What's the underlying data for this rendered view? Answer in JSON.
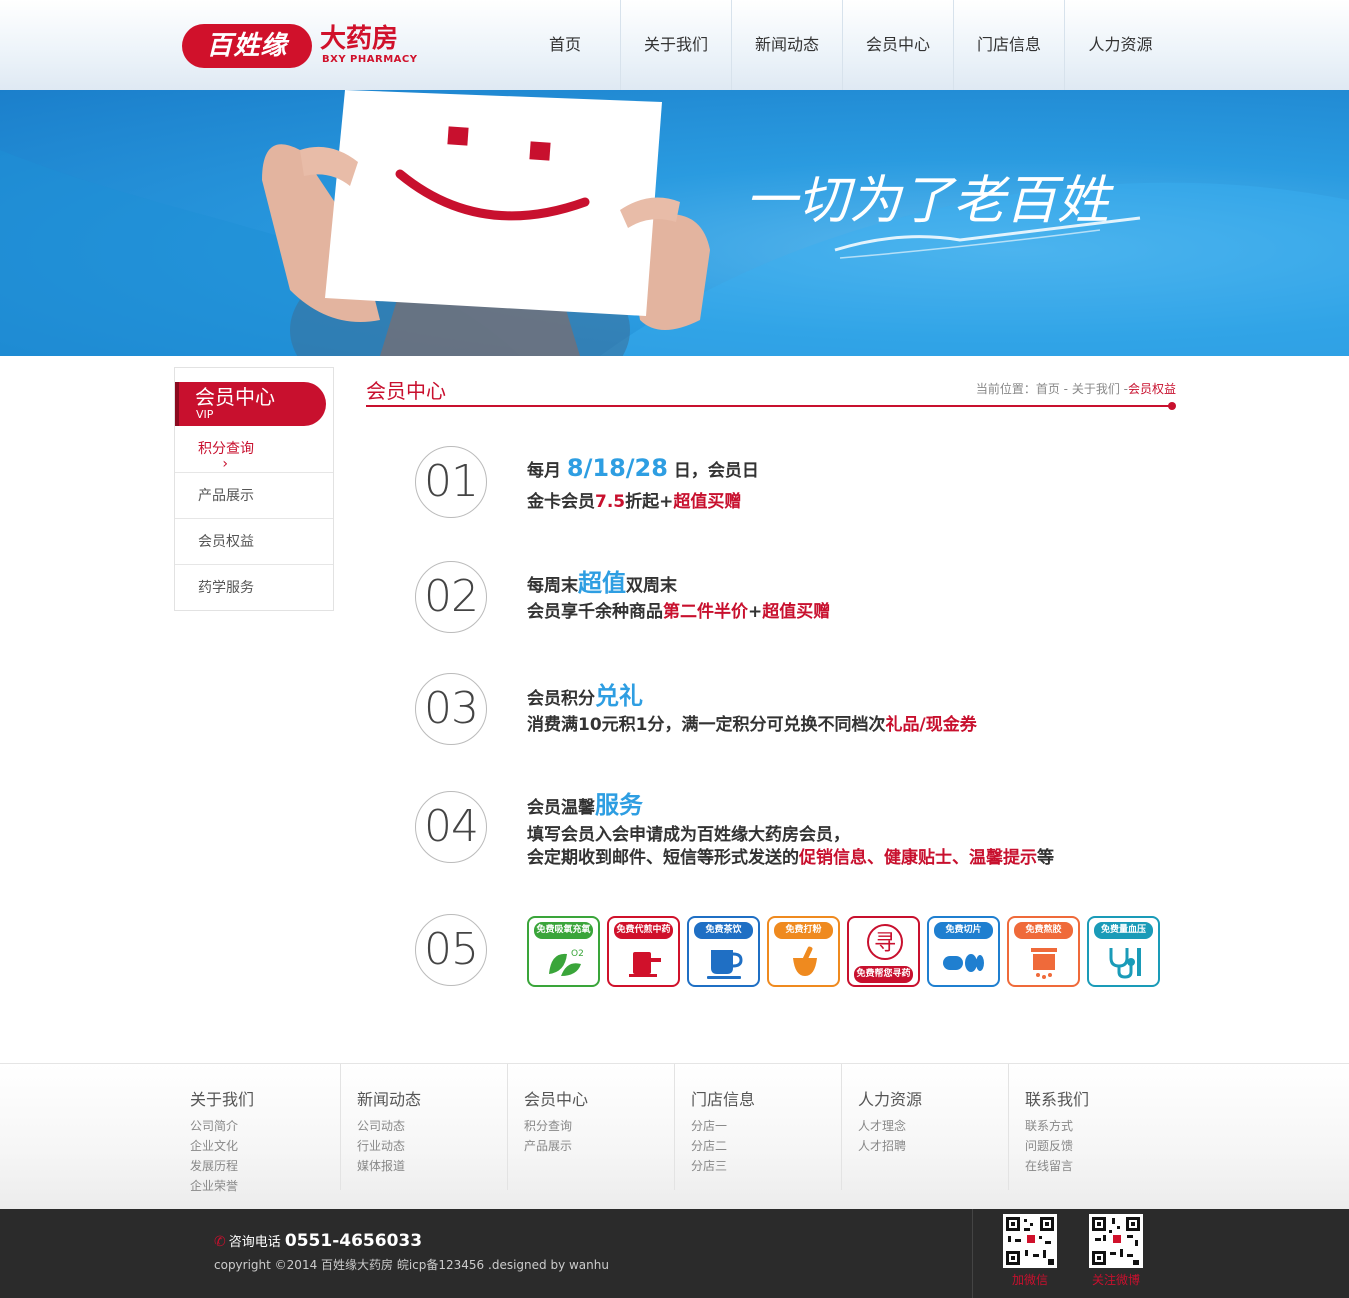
{
  "header": {
    "logo_pill": "百姓缘",
    "logo_cn": "大药房",
    "logo_en": "BXY PHARMACY",
    "nav": [
      "首页",
      "关于我们",
      "新闻动态",
      "会员中心",
      "门店信息",
      "人力资源"
    ]
  },
  "banner": {
    "slogan": "一切为了老百姓"
  },
  "sidebar": {
    "title": "会员中心",
    "subtitle": "VIP",
    "items": [
      "积分查询",
      "产品展示",
      "会员权益",
      "药学服务"
    ],
    "arrow": "›"
  },
  "main": {
    "title": "会员中心",
    "breadcrumb": {
      "prefix": "当前位置：",
      "home": "首页",
      "sep1": " - ",
      "about": "关于我们",
      "sep2": " -",
      "current": "会员权益"
    },
    "rows": [
      {
        "num": "01",
        "l1a": "每月 ",
        "l1b": "8/18/28",
        "l1c": " 日，会员日",
        "l2a": "金卡会员",
        "l2b": "7.5",
        "l2c": "折起+",
        "l2d": "超值买赠"
      },
      {
        "num": "02",
        "l1a": "每周末",
        "l1b": "超值",
        "l1c": "双周末",
        "l2a": "会员享千余种商品",
        "l2b": "第二件半价",
        "l2c": "+",
        "l2d": "超值买赠"
      },
      {
        "num": "03",
        "l1a": "会员积分",
        "l1b": "兑礼",
        "l2a": "消费满10元积1分，满一定积分可兑换不同档次",
        "l2b": "礼品/现金券"
      },
      {
        "num": "04",
        "l1a": "会员温馨",
        "l1b": "服务",
        "l2": "填写会员入会申请成为百姓缘大药房会员，",
        "l3a": "会定期收到邮件、短信等形式发送的",
        "l3b": "促销信息、健康贴士、温馨提示",
        "l3c": "等"
      },
      {
        "num": "05"
      }
    ],
    "services": [
      {
        "label": "免费吸氧充氧",
        "color": "#3aa53a"
      },
      {
        "label": "免费代煎中药",
        "color": "#d0112b"
      },
      {
        "label": "免费茶饮",
        "color": "#1f6fc4"
      },
      {
        "label": "免费打粉",
        "color": "#ef8a1f"
      },
      {
        "label": "免费帮您寻药",
        "color": "#c8102e",
        "glyph": "寻"
      },
      {
        "label": "免费切片",
        "color": "#1f7fd0"
      },
      {
        "label": "免费熬胶",
        "color": "#ef6a3a"
      },
      {
        "label": "免费量血压",
        "color": "#1a9bb8"
      }
    ]
  },
  "footer": {
    "columns": [
      {
        "title": "关于我们",
        "links": [
          "公司简介",
          "企业文化",
          "发展历程",
          "企业荣誉"
        ]
      },
      {
        "title": "新闻动态",
        "links": [
          "公司动态",
          "行业动态",
          "媒体报道"
        ]
      },
      {
        "title": "会员中心",
        "links": [
          "积分查询",
          "产品展示"
        ]
      },
      {
        "title": "门店信息",
        "links": [
          "分店一",
          "分店二",
          "分店三"
        ]
      },
      {
        "title": "人力资源",
        "links": [
          "人才理念",
          "人才招聘"
        ]
      },
      {
        "title": "联系我们",
        "links": [
          "联系方式",
          "问题反馈",
          "在线留言"
        ]
      }
    ],
    "phone_label": "咨询电话",
    "phone_number": "0551-4656033",
    "copyright": "copyright ©2014 百姓缘大药房 皖icp备123456 .designed by wanhu",
    "qr_labels": [
      "加微信",
      "关注微博"
    ]
  },
  "colors": {
    "brand_red": "#c8102e",
    "accent_blue": "#2e9ee2",
    "banner_blue": "#2a9be0"
  }
}
